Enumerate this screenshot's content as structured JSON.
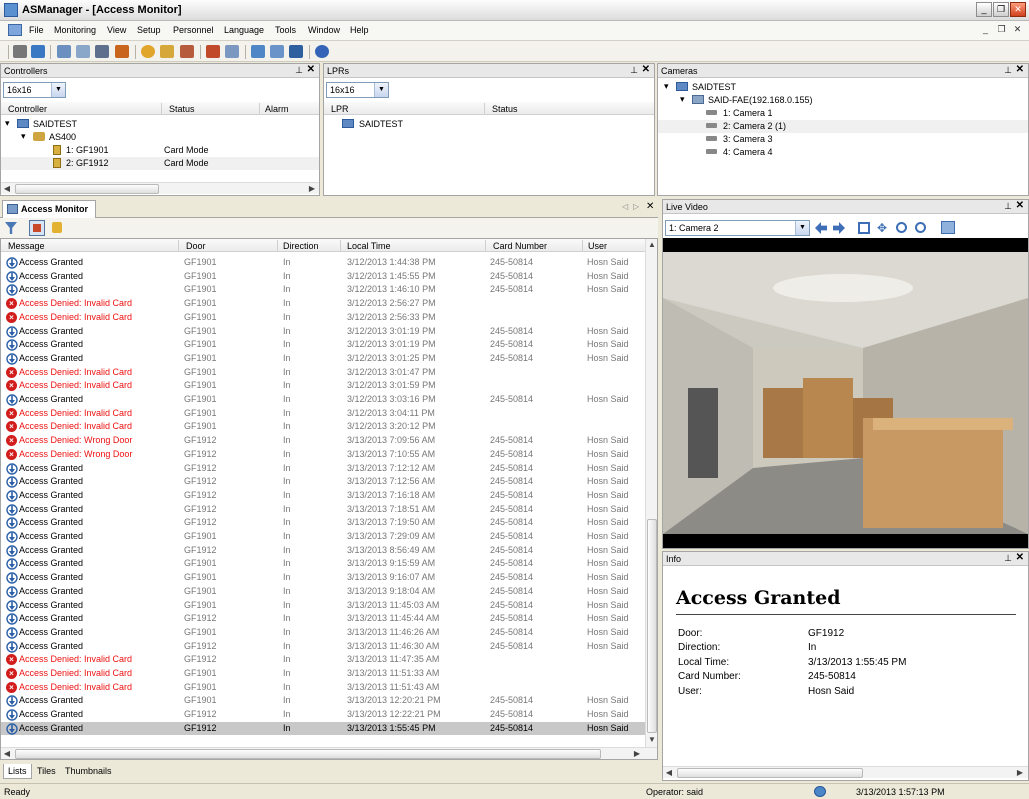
{
  "window": {
    "title": "ASManager - [Access Monitor]",
    "buttons": {
      "minimize": "_",
      "maximize": "❐",
      "close": "✕"
    }
  },
  "menu": [
    "File",
    "Monitoring",
    "View",
    "Setup",
    "Personnel",
    "Language",
    "Tools",
    "Window",
    "Help"
  ],
  "mdi_buttons": {
    "minimize": "_",
    "restore": "❐",
    "close": "✕"
  },
  "controllers": {
    "title": "Controllers",
    "combo_value": "16x16",
    "columns": [
      "Controller",
      "Status",
      "Alarm"
    ],
    "tree": [
      {
        "label": "SAIDTEST",
        "status": ""
      },
      {
        "label": "AS400",
        "status": ""
      },
      {
        "label": "1: GF1901",
        "status": "Card Mode"
      },
      {
        "label": "2: GF1912",
        "status": "Card Mode"
      }
    ]
  },
  "lprs": {
    "title": "LPRs",
    "combo_value": "16x16",
    "columns": [
      "LPR",
      "Status"
    ],
    "items": [
      "SAIDTEST"
    ]
  },
  "cameras": {
    "title": "Cameras",
    "tree": [
      {
        "label": "SAIDTEST"
      },
      {
        "label": "SAID-FAE(192.168.0.155)"
      },
      {
        "label": "1: Camera 1"
      },
      {
        "label": "2: Camera 2 (1)"
      },
      {
        "label": "3: Camera 3"
      },
      {
        "label": "4: Camera 4"
      }
    ]
  },
  "access_monitor": {
    "tab_label": "Access Monitor",
    "columns": [
      "Message",
      "Door",
      "Direction",
      "Local Time",
      "Card Number",
      "User"
    ],
    "rows": [
      {
        "msg": "Access Granted",
        "door": "GF1901",
        "dir": "In",
        "time": "3/12/2013 1:44:38 PM",
        "card": "245-50814",
        "user": "Hosn Said",
        "denied": false
      },
      {
        "msg": "Access Granted",
        "door": "GF1901",
        "dir": "In",
        "time": "3/12/2013 1:45:55 PM",
        "card": "245-50814",
        "user": "Hosn Said",
        "denied": false
      },
      {
        "msg": "Access Granted",
        "door": "GF1901",
        "dir": "In",
        "time": "3/12/2013 1:46:10 PM",
        "card": "245-50814",
        "user": "Hosn Said",
        "denied": false
      },
      {
        "msg": "Access Denied: Invalid Card",
        "door": "GF1901",
        "dir": "In",
        "time": "3/12/2013 2:56:27 PM",
        "card": "",
        "user": "",
        "denied": true
      },
      {
        "msg": "Access Denied: Invalid Card",
        "door": "GF1901",
        "dir": "In",
        "time": "3/12/2013 2:56:33 PM",
        "card": "",
        "user": "",
        "denied": true
      },
      {
        "msg": "Access Granted",
        "door": "GF1901",
        "dir": "In",
        "time": "3/12/2013 3:01:19 PM",
        "card": "245-50814",
        "user": "Hosn Said",
        "denied": false
      },
      {
        "msg": "Access Granted",
        "door": "GF1901",
        "dir": "In",
        "time": "3/12/2013 3:01:19 PM",
        "card": "245-50814",
        "user": "Hosn Said",
        "denied": false
      },
      {
        "msg": "Access Granted",
        "door": "GF1901",
        "dir": "In",
        "time": "3/12/2013 3:01:25 PM",
        "card": "245-50814",
        "user": "Hosn Said",
        "denied": false
      },
      {
        "msg": "Access Denied: Invalid Card",
        "door": "GF1901",
        "dir": "In",
        "time": "3/12/2013 3:01:47 PM",
        "card": "",
        "user": "",
        "denied": true
      },
      {
        "msg": "Access Denied: Invalid Card",
        "door": "GF1901",
        "dir": "In",
        "time": "3/12/2013 3:01:59 PM",
        "card": "",
        "user": "",
        "denied": true
      },
      {
        "msg": "Access Granted",
        "door": "GF1901",
        "dir": "In",
        "time": "3/12/2013 3:03:16 PM",
        "card": "245-50814",
        "user": "Hosn Said",
        "denied": false
      },
      {
        "msg": "Access Denied: Invalid Card",
        "door": "GF1901",
        "dir": "In",
        "time": "3/12/2013 3:04:11 PM",
        "card": "",
        "user": "",
        "denied": true
      },
      {
        "msg": "Access Denied: Invalid Card",
        "door": "GF1901",
        "dir": "In",
        "time": "3/12/2013 3:20:12 PM",
        "card": "",
        "user": "",
        "denied": true
      },
      {
        "msg": "Access Denied: Wrong Door",
        "door": "GF1912",
        "dir": "In",
        "time": "3/13/2013 7:09:56 AM",
        "card": "245-50814",
        "user": "Hosn Said",
        "denied": true
      },
      {
        "msg": "Access Denied: Wrong Door",
        "door": "GF1912",
        "dir": "In",
        "time": "3/13/2013 7:10:55 AM",
        "card": "245-50814",
        "user": "Hosn Said",
        "denied": true
      },
      {
        "msg": "Access Granted",
        "door": "GF1912",
        "dir": "In",
        "time": "3/13/2013 7:12:12 AM",
        "card": "245-50814",
        "user": "Hosn Said",
        "denied": false
      },
      {
        "msg": "Access Granted",
        "door": "GF1912",
        "dir": "In",
        "time": "3/13/2013 7:12:56 AM",
        "card": "245-50814",
        "user": "Hosn Said",
        "denied": false
      },
      {
        "msg": "Access Granted",
        "door": "GF1912",
        "dir": "In",
        "time": "3/13/2013 7:16:18 AM",
        "card": "245-50814",
        "user": "Hosn Said",
        "denied": false
      },
      {
        "msg": "Access Granted",
        "door": "GF1912",
        "dir": "In",
        "time": "3/13/2013 7:18:51 AM",
        "card": "245-50814",
        "user": "Hosn Said",
        "denied": false
      },
      {
        "msg": "Access Granted",
        "door": "GF1912",
        "dir": "In",
        "time": "3/13/2013 7:19:50 AM",
        "card": "245-50814",
        "user": "Hosn Said",
        "denied": false
      },
      {
        "msg": "Access Granted",
        "door": "GF1901",
        "dir": "In",
        "time": "3/13/2013 7:29:09 AM",
        "card": "245-50814",
        "user": "Hosn Said",
        "denied": false
      },
      {
        "msg": "Access Granted",
        "door": "GF1912",
        "dir": "In",
        "time": "3/13/2013 8:56:49 AM",
        "card": "245-50814",
        "user": "Hosn Said",
        "denied": false
      },
      {
        "msg": "Access Granted",
        "door": "GF1901",
        "dir": "In",
        "time": "3/13/2013 9:15:59 AM",
        "card": "245-50814",
        "user": "Hosn Said",
        "denied": false
      },
      {
        "msg": "Access Granted",
        "door": "GF1901",
        "dir": "In",
        "time": "3/13/2013 9:16:07 AM",
        "card": "245-50814",
        "user": "Hosn Said",
        "denied": false
      },
      {
        "msg": "Access Granted",
        "door": "GF1901",
        "dir": "In",
        "time": "3/13/2013 9:18:04 AM",
        "card": "245-50814",
        "user": "Hosn Said",
        "denied": false
      },
      {
        "msg": "Access Granted",
        "door": "GF1901",
        "dir": "In",
        "time": "3/13/2013 11:45:03 AM",
        "card": "245-50814",
        "user": "Hosn Said",
        "denied": false
      },
      {
        "msg": "Access Granted",
        "door": "GF1912",
        "dir": "In",
        "time": "3/13/2013 11:45:44 AM",
        "card": "245-50814",
        "user": "Hosn Said",
        "denied": false
      },
      {
        "msg": "Access Granted",
        "door": "GF1901",
        "dir": "In",
        "time": "3/13/2013 11:46:26 AM",
        "card": "245-50814",
        "user": "Hosn Said",
        "denied": false
      },
      {
        "msg": "Access Granted",
        "door": "GF1912",
        "dir": "In",
        "time": "3/13/2013 11:46:30 AM",
        "card": "245-50814",
        "user": "Hosn Said",
        "denied": false
      },
      {
        "msg": "Access Denied: Invalid Card",
        "door": "GF1912",
        "dir": "In",
        "time": "3/13/2013 11:47:35 AM",
        "card": "",
        "user": "",
        "denied": true
      },
      {
        "msg": "Access Denied: Invalid Card",
        "door": "GF1901",
        "dir": "In",
        "time": "3/13/2013 11:51:33 AM",
        "card": "",
        "user": "",
        "denied": true
      },
      {
        "msg": "Access Denied: Invalid Card",
        "door": "GF1901",
        "dir": "In",
        "time": "3/13/2013 11:51:43 AM",
        "card": "",
        "user": "",
        "denied": true
      },
      {
        "msg": "Access Granted",
        "door": "GF1901",
        "dir": "In",
        "time": "3/13/2013 12:20:21 PM",
        "card": "245-50814",
        "user": "Hosn Said",
        "denied": false
      },
      {
        "msg": "Access Granted",
        "door": "GF1912",
        "dir": "In",
        "time": "3/13/2013 12:22:21 PM",
        "card": "245-50814",
        "user": "Hosn Said",
        "denied": false
      },
      {
        "msg": "Access Granted",
        "door": "GF1912",
        "dir": "In",
        "time": "3/13/2013 1:55:45 PM",
        "card": "245-50814",
        "user": "Hosn Said",
        "denied": false,
        "selected": true
      }
    ],
    "bottom_tabs": [
      "Lists",
      "Tiles",
      "Thumbnails"
    ]
  },
  "live_video": {
    "title": "Live Video",
    "camera_select": "1: Camera 2"
  },
  "info": {
    "title": "Info",
    "heading": "Access Granted",
    "fields": [
      {
        "label": "Door:",
        "value": "GF1912"
      },
      {
        "label": "Direction:",
        "value": "In"
      },
      {
        "label": "Local Time:",
        "value": "3/13/2013 1:55:45 PM"
      },
      {
        "label": "Card Number:",
        "value": "245-50814"
      },
      {
        "label": "User:",
        "value": "Hosn Said"
      }
    ]
  },
  "status": {
    "left": "Ready",
    "operator": "Operator: said",
    "clock": "3/13/2013 1:57:13 PM"
  },
  "colors": {
    "denied_text": "#e11111",
    "selected_row": "#c8c8c8",
    "panel_header": "#e8e8e8"
  }
}
